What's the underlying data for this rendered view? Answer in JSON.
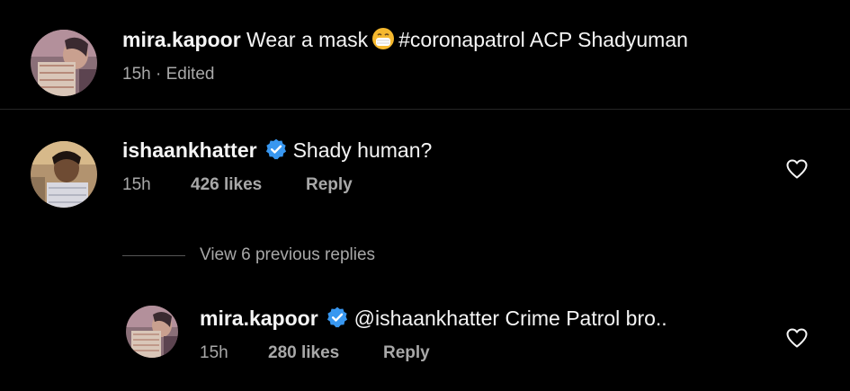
{
  "caption": {
    "username": "mira.kapoor",
    "text_before_emoji": "Wear a mask",
    "emoji": "face-with-medical-mask",
    "text_after_emoji": "#coronapatrol ACP Shadyuman",
    "time": "15h",
    "separator": "·",
    "edited": "Edited"
  },
  "comment": {
    "username": "ishaankhatter",
    "verified": true,
    "text": "Shady human?",
    "time": "15h",
    "likes": "426 likes",
    "reply": "Reply"
  },
  "view_replies": "View 6 previous replies",
  "reply": {
    "username": "mira.kapoor",
    "verified": true,
    "text": "@ishaankhatter Crime Patrol bro..",
    "time": "15h",
    "likes": "280 likes",
    "reply": "Reply"
  },
  "colors": {
    "background": "#000000",
    "text": "#f5f5f5",
    "secondary_text": "#a8a8a8",
    "verified_badge": "#3897f0",
    "divider": "#262626"
  }
}
